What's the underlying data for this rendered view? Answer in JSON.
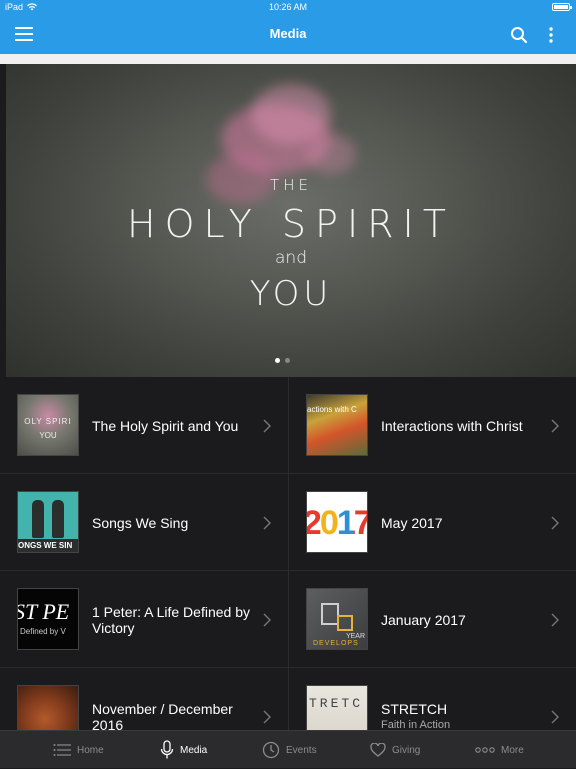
{
  "status_bar": {
    "device": "iPad",
    "time": "10:26 AM"
  },
  "navbar": {
    "title": "Media",
    "menu_icon": "hamburger-icon",
    "search_icon": "search-icon",
    "more_icon": "vertical-dots-icon"
  },
  "hero": {
    "line1": "THE",
    "line2": "HOLY SPIRIT",
    "line3": "and",
    "line4": "YOU",
    "pages": 2,
    "current_page": 1
  },
  "media": [
    {
      "title": "The Holy Spirit and You",
      "subtitle": "",
      "thumb_text": "OLY SPIRI",
      "thumb_text2": "YOU"
    },
    {
      "title": "Interactions with Christ",
      "subtitle": "",
      "thumb_text": "actions with C"
    },
    {
      "title": "Songs We Sing",
      "subtitle": "",
      "thumb_text": "ONGS WE SIN"
    },
    {
      "title": "May 2017",
      "subtitle": "",
      "thumb_text": "2017"
    },
    {
      "title": "1 Peter: A Life Defined by Victory",
      "subtitle": "",
      "thumb_text": "ST PE",
      "thumb_text2": "Defined by V"
    },
    {
      "title": "January 2017",
      "subtitle": "",
      "thumb_text": "YEAR",
      "thumb_text2": "DEVELOPS"
    },
    {
      "title": "November / December 2016",
      "subtitle": "",
      "thumb_text": ""
    },
    {
      "title": "STRETCH",
      "subtitle": "Faith in Action",
      "thumb_text": "TRETC"
    }
  ],
  "tabs": [
    {
      "label": "Home",
      "icon": "list-icon"
    },
    {
      "label": "Media",
      "icon": "microphone-icon",
      "active": true
    },
    {
      "label": "Events",
      "icon": "clock-icon"
    },
    {
      "label": "Giving",
      "icon": "heart-icon"
    },
    {
      "label": "More",
      "icon": "more-dots-icon"
    }
  ],
  "colors": {
    "accent": "#2a9be6",
    "background": "#1b1b1d"
  }
}
